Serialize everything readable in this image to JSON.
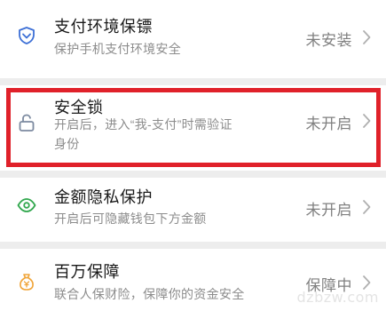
{
  "items": [
    {
      "title": "支付环境保镖",
      "subtitle": "保护手机支付环境安全",
      "status": "未安装",
      "icon": "shield-check-icon",
      "icon_color": "#3c6fd6"
    },
    {
      "title": "安全锁",
      "subtitle_line1": "开启后，进入“我-支付”时需验证",
      "subtitle_line2": "身份",
      "status": "未开启",
      "icon": "unlock-icon",
      "icon_color": "#7c8aa0"
    },
    {
      "title": "金额隐私保护",
      "subtitle": "开启后可隐藏钱包下方金额",
      "status": "未开启",
      "icon": "eye-icon",
      "icon_color": "#33a84f"
    },
    {
      "title": "百万保障",
      "subtitle": "联合人保财险，保障你的资金安全",
      "status": "保障中",
      "icon": "money-bag-icon",
      "icon_color": "#f0a53a"
    }
  ],
  "highlight_color": "#e0212a",
  "watermark": "dzbzw.com"
}
